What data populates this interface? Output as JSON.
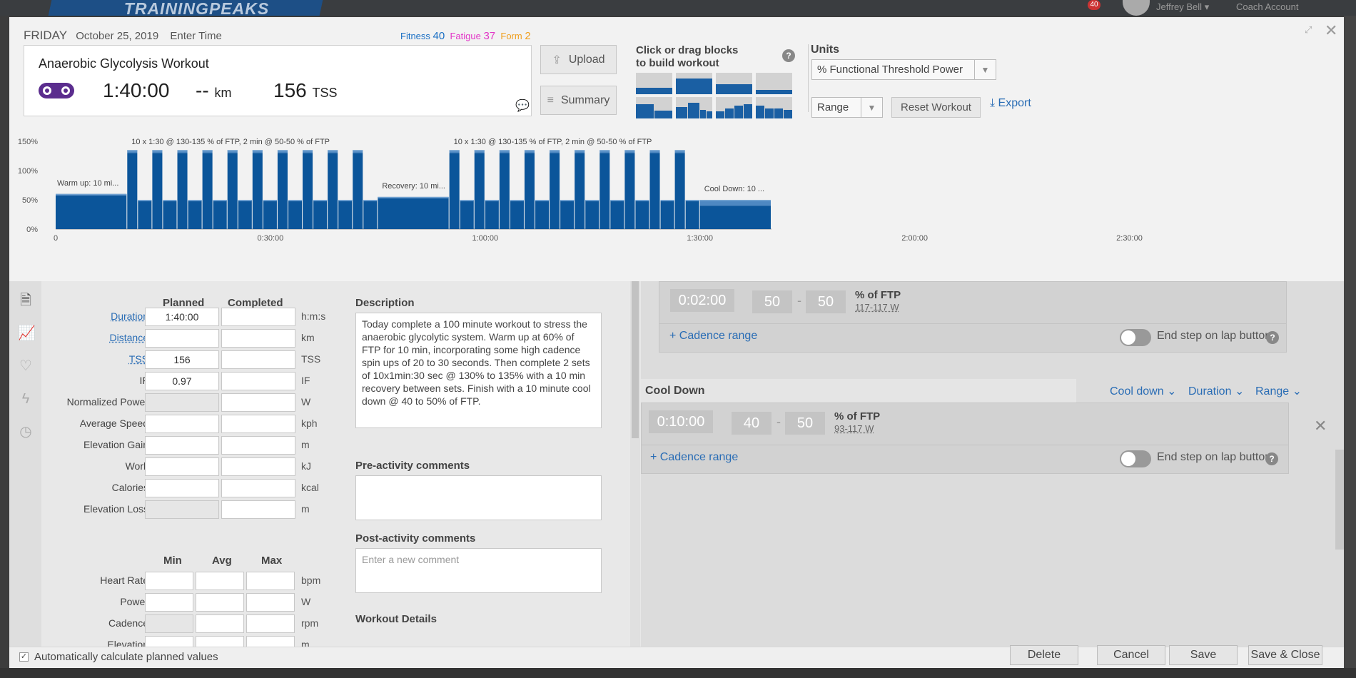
{
  "topbar": {
    "brand": "TRAININGPEAKS",
    "notifications": "40",
    "user": "Jeffrey Bell",
    "coach": "Coach Account"
  },
  "header": {
    "day": "FRIDAY",
    "date": "October 25, 2019",
    "enter_time": "Enter Time",
    "fitness_label": "Fitness",
    "fitness": "40",
    "fatigue_label": "Fatigue",
    "fatigue": "37",
    "form_label": "Form",
    "form": "2",
    "colors": {
      "fitness": "#1a6fc4",
      "fatigue": "#e236c7",
      "form": "#f0a020"
    }
  },
  "workout": {
    "title": "Anaerobic Glycolysis Workout",
    "duration": "1:40:00",
    "distance": "--",
    "distance_unit": "km",
    "tss": "156",
    "tss_unit": "TSS"
  },
  "buttons": {
    "upload": "Upload",
    "summary": "Summary",
    "reset": "Reset Workout",
    "export": "Export"
  },
  "builder": {
    "line1": "Click or drag blocks",
    "line2": "to build workout",
    "help": "?"
  },
  "units": {
    "label": "Units",
    "value": "% Functional Threshold Power",
    "range": "Range"
  },
  "chart_data": {
    "type": "bar",
    "ylabels": [
      "150%",
      "100%",
      "50%",
      "0%"
    ],
    "xlabels": [
      "0",
      "0:30:00",
      "1:00:00",
      "1:30:00",
      "2:00:00",
      "2:30:00"
    ],
    "xmax_min": 165,
    "ymax": 150,
    "annotations": [
      {
        "text": "Warm up: 10 mi...",
        "at": 0
      },
      {
        "text": "10 x 1:30 @ 130-135 % of FTP, 2 min @ 50-50 % of FTP",
        "at": 10
      },
      {
        "text": "Recovery: 10 mi...",
        "at": 45
      },
      {
        "text": "10 x 1:30 @ 130-135 % of FTP, 2 min @ 50-50 % of FTP",
        "at": 55
      },
      {
        "text": "Cool Down: 10 ...",
        "at": 90
      }
    ],
    "segments": [
      {
        "s": 0,
        "d": 10,
        "lo": 60,
        "hi": 60
      },
      {
        "s": 10,
        "d": 1.5,
        "lo": 130,
        "hi": 135
      },
      {
        "s": 11.5,
        "d": 2,
        "lo": 50,
        "hi": 50
      },
      {
        "s": 13.5,
        "d": 1.5,
        "lo": 130,
        "hi": 135
      },
      {
        "s": 15,
        "d": 2,
        "lo": 50,
        "hi": 50
      },
      {
        "s": 17,
        "d": 1.5,
        "lo": 130,
        "hi": 135
      },
      {
        "s": 18.5,
        "d": 2,
        "lo": 50,
        "hi": 50
      },
      {
        "s": 20.5,
        "d": 1.5,
        "lo": 130,
        "hi": 135
      },
      {
        "s": 22,
        "d": 2,
        "lo": 50,
        "hi": 50
      },
      {
        "s": 24,
        "d": 1.5,
        "lo": 130,
        "hi": 135
      },
      {
        "s": 25.5,
        "d": 2,
        "lo": 50,
        "hi": 50
      },
      {
        "s": 27.5,
        "d": 1.5,
        "lo": 130,
        "hi": 135
      },
      {
        "s": 29,
        "d": 2,
        "lo": 50,
        "hi": 50
      },
      {
        "s": 31,
        "d": 1.5,
        "lo": 130,
        "hi": 135
      },
      {
        "s": 32.5,
        "d": 2,
        "lo": 50,
        "hi": 50
      },
      {
        "s": 34.5,
        "d": 1.5,
        "lo": 130,
        "hi": 135
      },
      {
        "s": 36,
        "d": 2,
        "lo": 50,
        "hi": 50
      },
      {
        "s": 38,
        "d": 1.5,
        "lo": 130,
        "hi": 135
      },
      {
        "s": 39.5,
        "d": 2,
        "lo": 50,
        "hi": 50
      },
      {
        "s": 41.5,
        "d": 1.5,
        "lo": 130,
        "hi": 135
      },
      {
        "s": 43,
        "d": 2,
        "lo": 50,
        "hi": 50
      },
      {
        "s": 45,
        "d": 10,
        "lo": 55,
        "hi": 55
      },
      {
        "s": 55,
        "d": 1.5,
        "lo": 130,
        "hi": 135
      },
      {
        "s": 56.5,
        "d": 2,
        "lo": 50,
        "hi": 50
      },
      {
        "s": 58.5,
        "d": 1.5,
        "lo": 130,
        "hi": 135
      },
      {
        "s": 60,
        "d": 2,
        "lo": 50,
        "hi": 50
      },
      {
        "s": 62,
        "d": 1.5,
        "lo": 130,
        "hi": 135
      },
      {
        "s": 63.5,
        "d": 2,
        "lo": 50,
        "hi": 50
      },
      {
        "s": 65.5,
        "d": 1.5,
        "lo": 130,
        "hi": 135
      },
      {
        "s": 67,
        "d": 2,
        "lo": 50,
        "hi": 50
      },
      {
        "s": 69,
        "d": 1.5,
        "lo": 130,
        "hi": 135
      },
      {
        "s": 70.5,
        "d": 2,
        "lo": 50,
        "hi": 50
      },
      {
        "s": 72.5,
        "d": 1.5,
        "lo": 130,
        "hi": 135
      },
      {
        "s": 74,
        "d": 2,
        "lo": 50,
        "hi": 50
      },
      {
        "s": 76,
        "d": 1.5,
        "lo": 130,
        "hi": 135
      },
      {
        "s": 77.5,
        "d": 2,
        "lo": 50,
        "hi": 50
      },
      {
        "s": 79.5,
        "d": 1.5,
        "lo": 130,
        "hi": 135
      },
      {
        "s": 81,
        "d": 2,
        "lo": 50,
        "hi": 50
      },
      {
        "s": 83,
        "d": 1.5,
        "lo": 130,
        "hi": 135
      },
      {
        "s": 84.5,
        "d": 2,
        "lo": 50,
        "hi": 50
      },
      {
        "s": 86.5,
        "d": 1.5,
        "lo": 130,
        "hi": 135
      },
      {
        "s": 88,
        "d": 2,
        "lo": 50,
        "hi": 50
      },
      {
        "s": 90,
        "d": 10,
        "lo": 40,
        "hi": 50
      }
    ]
  },
  "fields": {
    "planned": "Planned",
    "completed": "Completed",
    "rows": [
      {
        "label": "Duration",
        "link": true,
        "planned": "1:40:00",
        "unit": "h:m:s"
      },
      {
        "label": "Distance",
        "link": true,
        "planned": "",
        "unit": "km"
      },
      {
        "label": "TSS",
        "link": true,
        "planned": "156",
        "unit": "TSS"
      },
      {
        "label": "IF",
        "link": false,
        "planned": "0.97",
        "unit": "IF"
      },
      {
        "label": "Normalized Power",
        "link": false,
        "planned": "",
        "unit": "W",
        "dis": true
      },
      {
        "label": "Average Speed",
        "link": false,
        "planned": "",
        "unit": "kph"
      },
      {
        "label": "Elevation Gain",
        "link": false,
        "planned": "",
        "unit": "m"
      },
      {
        "label": "Work",
        "link": false,
        "planned": "",
        "unit": "kJ"
      },
      {
        "label": "Calories",
        "link": false,
        "planned": "",
        "unit": "kcal"
      },
      {
        "label": "Elevation Loss",
        "link": false,
        "planned": "",
        "unit": "m",
        "dis": true
      }
    ],
    "min": "Min",
    "avg": "Avg",
    "max": "Max",
    "rows2": [
      {
        "label": "Heart Rate",
        "unit": "bpm"
      },
      {
        "label": "Power",
        "unit": "W"
      },
      {
        "label": "Cadence",
        "unit": "rpm",
        "dis": true
      },
      {
        "label": "Elevation",
        "unit": "m"
      }
    ]
  },
  "description": {
    "title": "Description",
    "text": "Today complete a 100 minute workout to stress the anaerobic glycolytic system. Warm up at 60% of FTP for 10 min, incorporating some high cadence spin ups of 20 to 30 seconds. Then complete 2 sets of 10x1min:30 sec @ 130% to 135% with a 10 min recovery between sets. Finish with a 10 minute cool down @ 40 to 50% of FTP.",
    "pre_title": "Pre-activity comments",
    "post_title": "Post-activity comments",
    "post_placeholder": "Enter a new comment",
    "details_title": "Workout Details"
  },
  "steps": {
    "step1": {
      "time": "0:02:00",
      "lo": "50",
      "hi": "50",
      "unit": "% of FTP",
      "watts": "117-117 W"
    },
    "cadence": "Cadence range",
    "end_lap": "End step on lap button",
    "cooldown": {
      "title": "Cool Down",
      "type": "Cool down",
      "duration": "Duration",
      "range": "Range",
      "time": "0:10:00",
      "lo": "40",
      "hi": "50",
      "unit": "% of FTP",
      "watts": "93-117 W"
    }
  },
  "footer": {
    "auto": "Automatically calculate planned values",
    "delete": "Delete",
    "cancel": "Cancel",
    "save": "Save",
    "save_close": "Save & Close"
  }
}
